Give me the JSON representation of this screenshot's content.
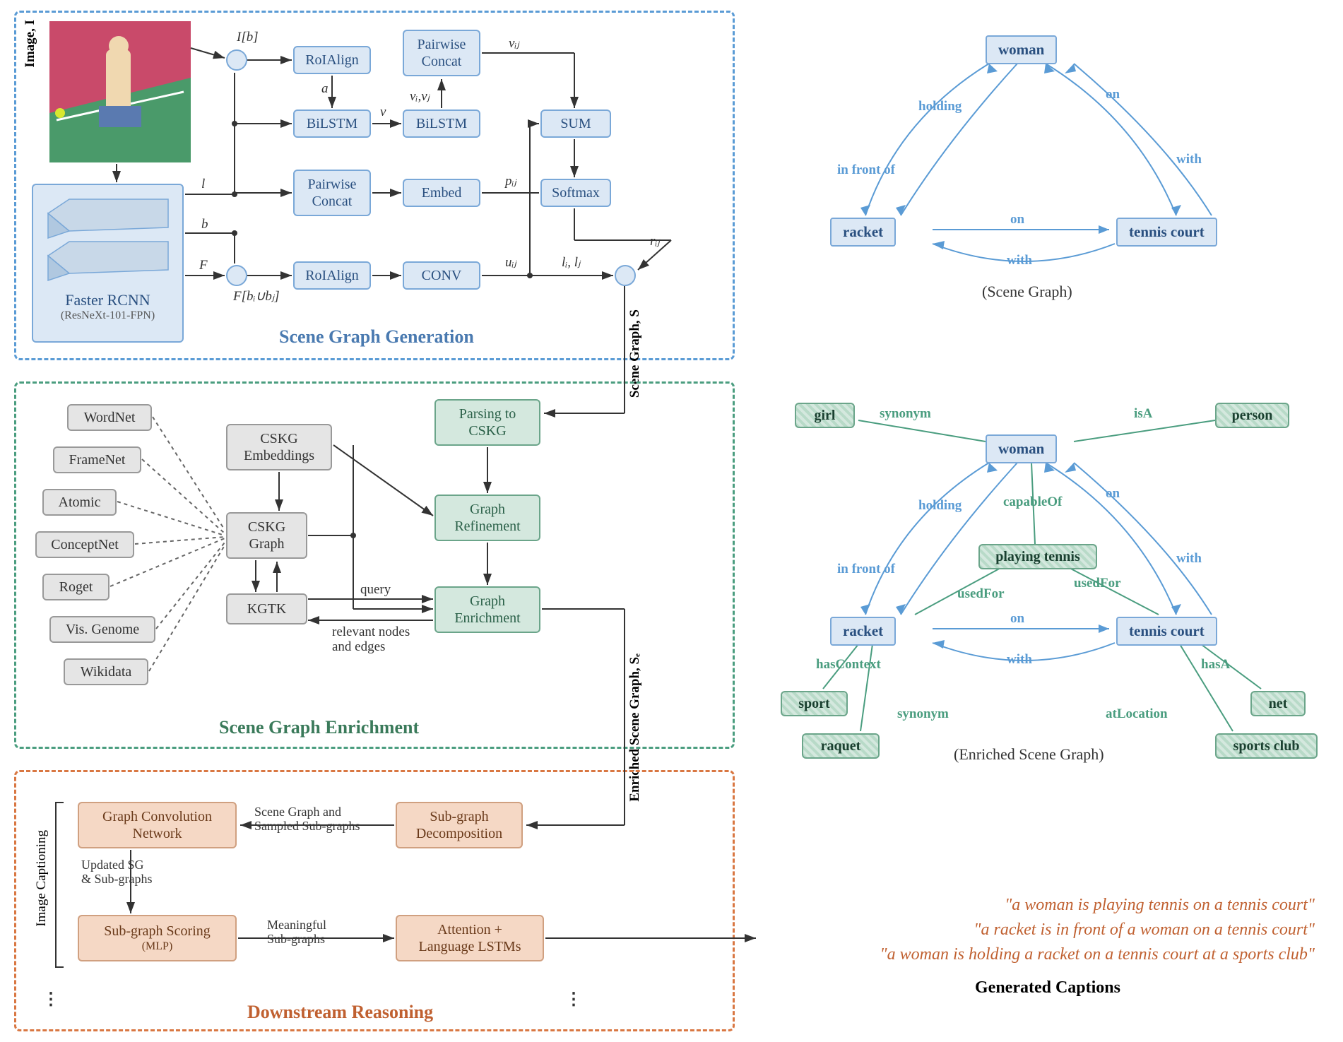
{
  "panels": {
    "sgg": {
      "title": "Scene Graph Generation"
    },
    "sge": {
      "title": "Scene Graph Enrichment"
    },
    "dr": {
      "title": "Downstream Reasoning"
    }
  },
  "input_label": "Image, I",
  "detector": {
    "name": "Faster RCNN",
    "backbone": "(ResNeXt-101-FPN)"
  },
  "sgg_nodes": {
    "roialign1": "RoIAlign",
    "roialign2": "RoIAlign",
    "bilstm1": "BiLSTM",
    "bilstm2": "BiLSTM",
    "pwconcat1": "Pairwise\nConcat",
    "pwconcat2": "Pairwise\nConcat",
    "embed": "Embed",
    "conv": "CONV",
    "sum": "SUM",
    "softmax": "Softmax"
  },
  "sgg_edge_labels": {
    "Ib": "I[b]",
    "l": "l",
    "b": "b",
    "F": "F",
    "Fbibj": "F[bᵢ∪bⱼ]",
    "a": "a",
    "v": "v",
    "vivj": "vᵢ,vⱼ",
    "vij": "vᵢⱼ",
    "pij": "pᵢⱼ",
    "uij": "uᵢⱼ",
    "lilj": "lᵢ, lⱼ",
    "rij": "rᵢⱼ",
    "scene_graph": "Scene Graph, S",
    "enriched": "Enriched Scene Graph, Sₑ"
  },
  "kb_sources": [
    "WordNet",
    "FrameNet",
    "Atomic",
    "ConceptNet",
    "Roget",
    "Vis. Genome",
    "Wikidata"
  ],
  "sge_nodes": {
    "cskg_emb": "CSKG\nEmbeddings",
    "cskg_graph": "CSKG\nGraph",
    "kgtk": "KGTK",
    "parse": "Parsing to\nCSKG",
    "refine": "Graph\nRefinement",
    "enrich": "Graph\nEnrichment"
  },
  "sge_edge_labels": {
    "query": "query",
    "relevant": "relevant nodes\nand edges"
  },
  "dr_nodes": {
    "subgraph_decomp": "Sub-graph\nDecomposition",
    "gcn": "Graph Convolution\nNetwork",
    "scoring": "Sub-graph Scoring",
    "scoring_sub": "(MLP)",
    "lstm": "Attention +\nLanguage LSTMs"
  },
  "dr_edge_labels": {
    "sg_sampled": "Scene Graph and\nSampled Sub-graphs",
    "updated": "Updated SG\n& Sub-graphs",
    "meaningful": "Meaningful\nSub-graphs"
  },
  "image_captioning_label": "Image Captioning",
  "scene_graph": {
    "caption": "(Scene Graph)",
    "nodes": {
      "woman": "woman",
      "racket": "racket",
      "court": "tennis court"
    },
    "edges": {
      "holding": "holding",
      "on": "on",
      "infrontof": "in front of",
      "with": "with",
      "on2": "on",
      "with2": "with"
    }
  },
  "enriched_graph": {
    "caption": "(Enriched Scene Graph)",
    "base_nodes": {
      "woman": "woman",
      "racket": "racket",
      "court": "tennis court"
    },
    "ext_nodes": {
      "girl": "girl",
      "person": "person",
      "playing": "playing tennis",
      "sport": "sport",
      "raquet": "raquet",
      "net": "net",
      "sportsclub": "sports club"
    },
    "ext_edges": {
      "synonym1": "synonym",
      "isa": "isA",
      "capableof": "capableOf",
      "usedfor1": "usedFor",
      "usedfor2": "usedFor",
      "hascontext": "hasContext",
      "synonym2": "synonym",
      "hasa": "hasA",
      "atlocation": "atLocation"
    },
    "base_edges": {
      "holding": "holding",
      "on": "on",
      "infrontof": "in front of",
      "with": "with",
      "on2": "on",
      "with2": "with"
    }
  },
  "generated_captions": {
    "title": "Generated Captions",
    "c1": "\"a woman is playing tennis on a tennis court\"",
    "c2": "\"a racket is in front of a woman on a tennis court\"",
    "c3": "\"a woman is holding a racket on a tennis court at a sports club\""
  }
}
